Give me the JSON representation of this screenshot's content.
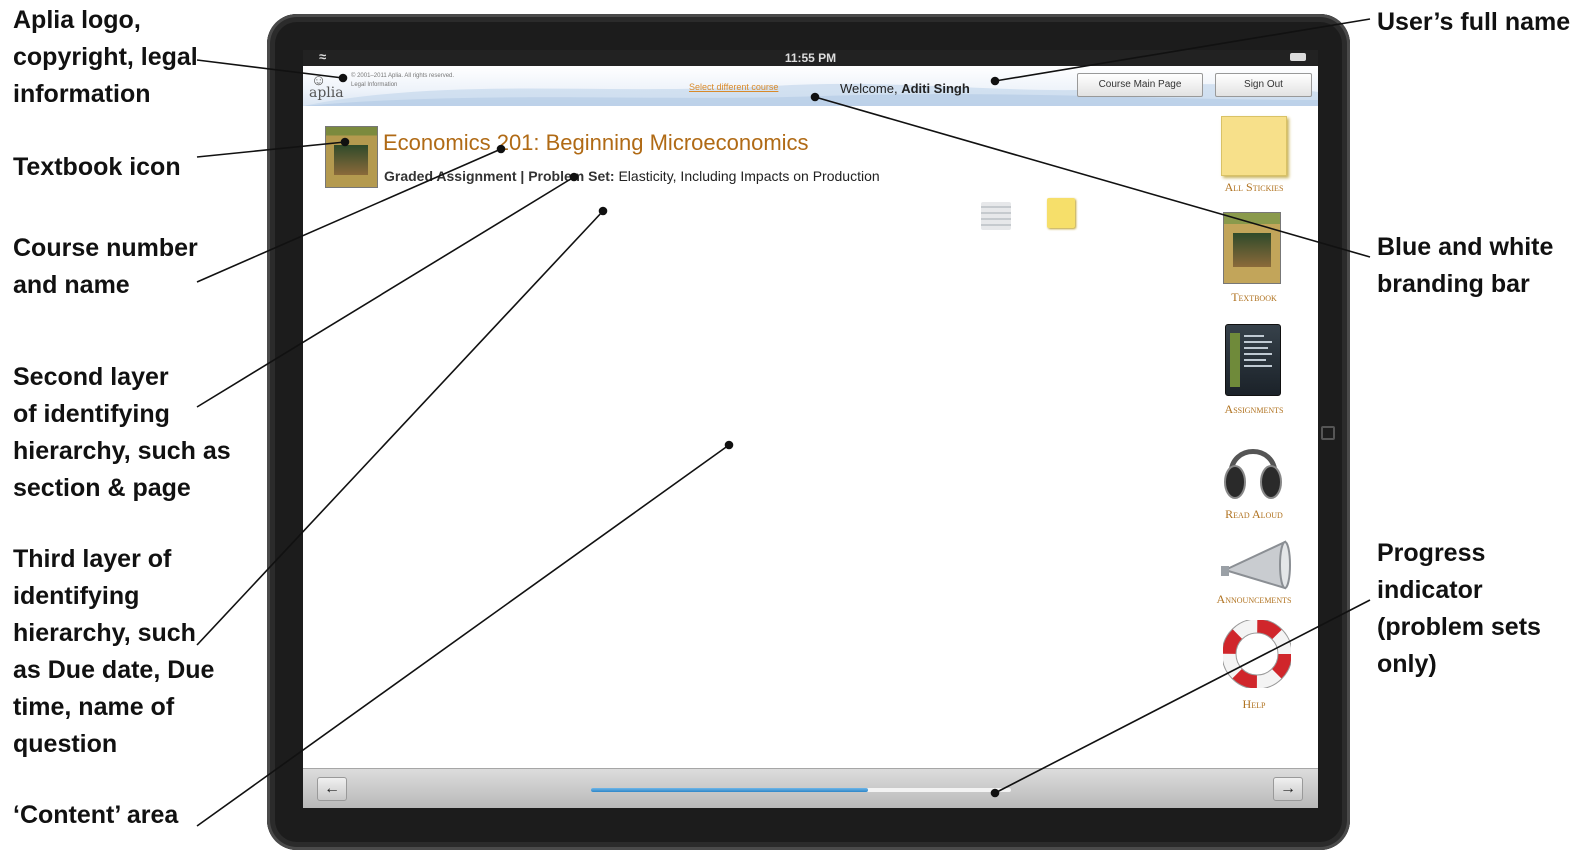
{
  "status_bar": {
    "time": "11:55 PM"
  },
  "header": {
    "logo_text": "aplia",
    "legal_line1": "© 2001–2011 Aplia. All rights reserved.",
    "legal_line2": "Legal Information",
    "select_course": "Select different course",
    "welcome_prefix": "Welcome,",
    "user_name": "Aditi Singh",
    "course_main_page": "Course Main Page",
    "sign_out": "Sign Out"
  },
  "course": {
    "title": "Economics 201: Beginning Microeconomics",
    "label": "Graded Assignment | Problem Set:",
    "subtitle": "Elasticity, Including Impacts on Production"
  },
  "sidebar": {
    "items": [
      {
        "label": "All Stickies",
        "icon": "sticky-note-icon"
      },
      {
        "label": "Textbook",
        "icon": "textbook-icon"
      },
      {
        "label": "Assignments",
        "icon": "assignments-icon"
      },
      {
        "label": "Read Aloud",
        "icon": "headphones-icon"
      },
      {
        "label": "Announcements",
        "icon": "megaphone-icon"
      },
      {
        "label": "Help",
        "icon": "lifebuoy-icon"
      }
    ]
  },
  "progress": {
    "fraction": 0.66
  },
  "annotations": {
    "left": [
      "Aplia logo,",
      "copyright, legal",
      "information",
      "Textbook icon",
      "Course number",
      "and name",
      "Second layer",
      "of identifying",
      "hierarchy, such as",
      "section & page",
      "Third layer of",
      "identifying",
      "hierarchy, such",
      "as Due date, Due",
      "time, name of",
      "question",
      "‘Content’ area"
    ],
    "right": [
      "User’s full name",
      "Blue and white",
      "branding bar",
      "Progress",
      "indicator",
      "(problem sets",
      "only)"
    ]
  },
  "colors": {
    "brand_orange": "#b06a15",
    "progress_blue": "#2e86c8",
    "device_bezel": "#1c1c1c"
  }
}
